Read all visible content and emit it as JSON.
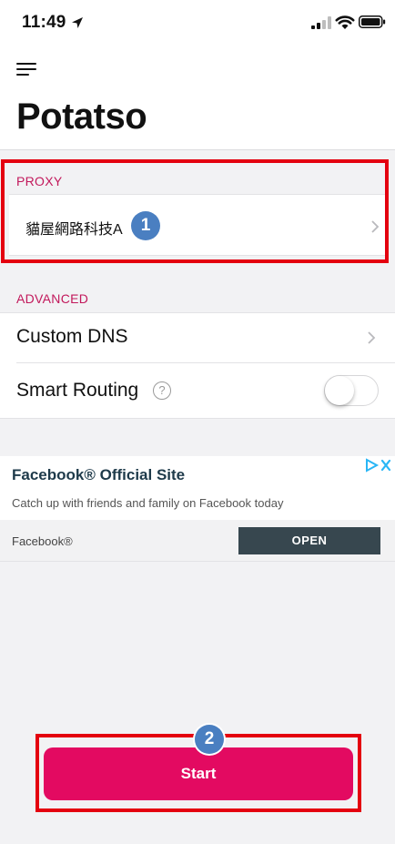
{
  "status_bar": {
    "time": "11:49"
  },
  "header": {
    "title": "Potatso"
  },
  "proxy": {
    "section_label": "PROXY",
    "selected_proxy": "貓屋網路科技A",
    "badge_number": "1"
  },
  "advanced": {
    "section_label": "ADVANCED",
    "custom_dns_label": "Custom DNS",
    "smart_routing_label": "Smart Routing",
    "help_glyph": "?",
    "smart_routing_enabled": false
  },
  "ad": {
    "title": "Facebook® Official Site",
    "description": "Catch up with friends and family on Facebook today",
    "source": "Facebook®",
    "cta_label": "OPEN"
  },
  "start": {
    "label": "Start",
    "badge_number": "2"
  },
  "colors": {
    "accent": "#e30a61",
    "section_header": "#c2185b",
    "highlight": "#e4000f",
    "badge": "#4a7fc1",
    "ad_button": "#37474f"
  },
  "icons": [
    "location-arrow-icon",
    "signal-icon",
    "wifi-icon",
    "battery-icon",
    "hamburger-menu-icon",
    "chevron-right-icon",
    "help-icon",
    "ad-choices-icon"
  ]
}
